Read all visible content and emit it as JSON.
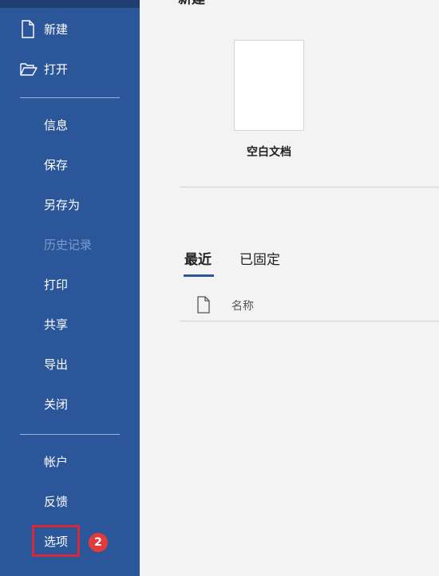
{
  "sidebar": {
    "items": [
      {
        "label": "新建",
        "icon": "new-document-icon",
        "disabled": false
      },
      {
        "label": "打开",
        "icon": "folder-open-icon",
        "disabled": false
      },
      {
        "label": "信息",
        "disabled": false
      },
      {
        "label": "保存",
        "disabled": false
      },
      {
        "label": "另存为",
        "disabled": false
      },
      {
        "label": "历史记录",
        "disabled": true
      },
      {
        "label": "打印",
        "disabled": false
      },
      {
        "label": "共享",
        "disabled": false
      },
      {
        "label": "导出",
        "disabled": false
      },
      {
        "label": "关闭",
        "disabled": false
      },
      {
        "label": "帐户",
        "disabled": false
      },
      {
        "label": "反馈",
        "disabled": false
      },
      {
        "label": "选项",
        "disabled": false
      }
    ],
    "badge": "2"
  },
  "main": {
    "section_title": "新建",
    "blank_label": "空白文档",
    "tabs": [
      {
        "label": "最近",
        "active": true
      },
      {
        "label": "已固定",
        "active": false
      }
    ],
    "list_header": {
      "name_label": "名称"
    }
  },
  "colors": {
    "sidebar_bg": "#2b579a",
    "highlight_border": "#d6293c",
    "badge_bg": "#e23b3b"
  }
}
